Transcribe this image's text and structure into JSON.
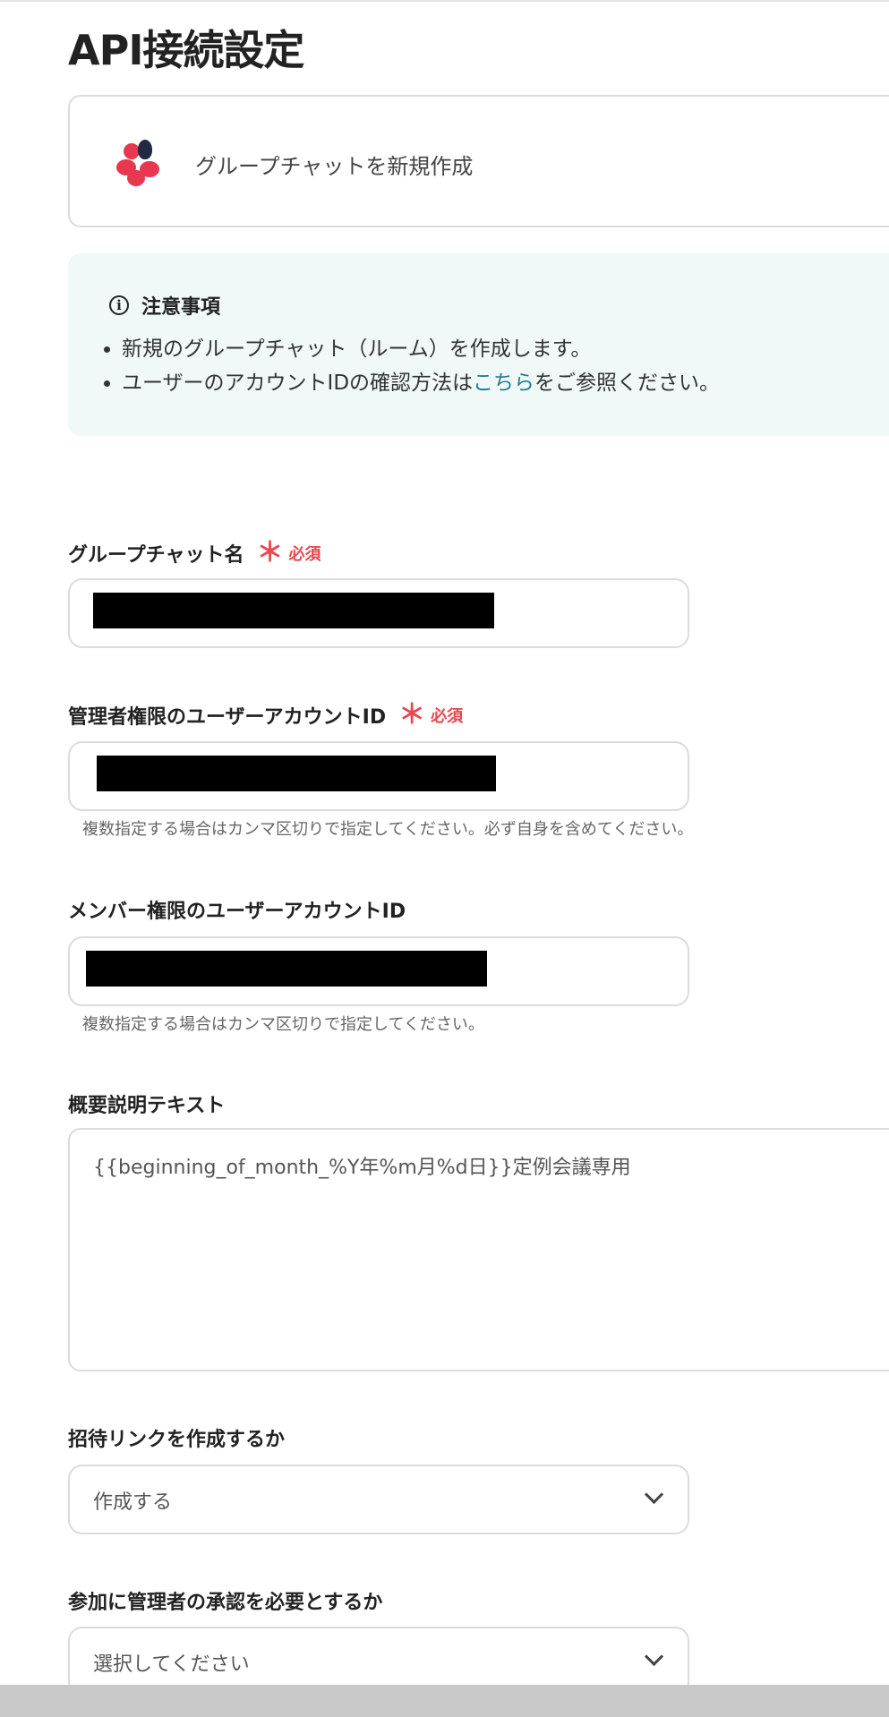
{
  "page": {
    "title": "API接続設定"
  },
  "app": {
    "action_label": "グループチャットを新規作成",
    "logo_colors": [
      "#e8384f",
      "#e8384f",
      "#e8384f",
      "#1f2a44"
    ]
  },
  "notice": {
    "title": "注意事項",
    "items": [
      {
        "text": "新規のグループチャット（ルーム）を作成します。"
      },
      {
        "prefix": "ユーザーのアカウントIDの確認方法は",
        "link": "こちら",
        "suffix": "をご参照ください。"
      }
    ]
  },
  "required_label": "必須",
  "required_mark": "＊",
  "fields": {
    "group_name": {
      "label": "グループチャット名",
      "value": ""
    },
    "admin_ids": {
      "label": "管理者権限のユーザーアカウントID",
      "value": "",
      "hint": "複数指定する場合はカンマ区切りで指定してください。必ず自身を含めてください。"
    },
    "member_ids": {
      "label": "メンバー権限のユーザーアカウントID",
      "value": "",
      "hint": "複数指定する場合はカンマ区切りで指定してください。"
    },
    "description": {
      "label": "概要説明テキスト",
      "value": "{{beginning_of_month_%Y年%m月%d日}}定例会議専用"
    },
    "invite_link": {
      "label": "招待リンクを作成するか",
      "selected": "作成する"
    },
    "approval": {
      "label": "参加に管理者の承認を必要とするか",
      "selected": "選択してください"
    }
  },
  "colors": {
    "accent_link": "#1a7f8e",
    "required": "#e8484e",
    "notice_bg": "#f1f8f8"
  }
}
